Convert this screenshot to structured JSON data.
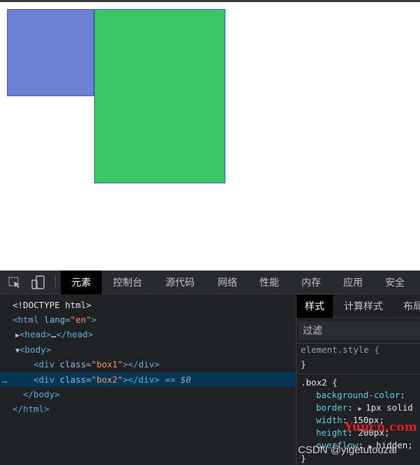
{
  "devtools": {
    "toolbar": {
      "icons": [
        "inspect-element-icon",
        "device-toolbar-icon"
      ],
      "tabs": [
        {
          "label": "元素",
          "active": true
        },
        {
          "label": "控制台",
          "active": false
        },
        {
          "label": "源代码",
          "active": false
        },
        {
          "label": "网络",
          "active": false
        },
        {
          "label": "性能",
          "active": false
        },
        {
          "label": "内存",
          "active": false
        },
        {
          "label": "应用",
          "active": false
        },
        {
          "label": "安全",
          "active": false
        }
      ]
    },
    "dom": {
      "doctype": "<!DOCTYPE html>",
      "html_open_tag": "<html",
      "html_lang_attr": " lang=",
      "html_lang_val": "\"en\"",
      "html_open_end": ">",
      "head_collapsed": "<head>",
      "head_ellipsis": "…",
      "head_close": "</head>",
      "body_open": "<body>",
      "div1_open": "<div",
      "div1_attr": " class=",
      "div1_val": "\"box1\"",
      "div1_close": "></div>",
      "div2_open": "<div",
      "div2_attr": " class=",
      "div2_val": "\"box2\"",
      "div2_close": "></div>",
      "div2_eq": " == ",
      "div2_ref": "$0",
      "selected_dots": "…",
      "body_close": "</body>",
      "html_close": "</html>"
    },
    "styles_pane": {
      "tabs": [
        {
          "label": "样式",
          "active": true
        },
        {
          "label": "计算样式",
          "active": false
        },
        {
          "label": "布局",
          "active": false
        }
      ],
      "filter_placeholder": "过滤",
      "element_style_selector": "element.style {",
      "element_style_close": "}",
      "rule_selector": ".box2 {",
      "rule_decls": [
        {
          "prop": "background-color",
          "sep": ": ",
          "value": ""
        },
        {
          "prop": "border",
          "sep": ": ",
          "value": "1px solid"
        },
        {
          "prop": "width",
          "sep": ": ",
          "value": "150px;"
        },
        {
          "prop": "height",
          "sep": ": ",
          "value": "200px;"
        },
        {
          "prop": "overflow",
          "sep": ": ",
          "value": "hidden;"
        }
      ],
      "rule_close": "}"
    }
  },
  "viewport": {
    "box1_color": "#6b80d2",
    "box2_color": "#3cc567"
  },
  "watermarks": {
    "red": "Yuucn.com",
    "csdn": "CSDN @yigetutouzai"
  }
}
